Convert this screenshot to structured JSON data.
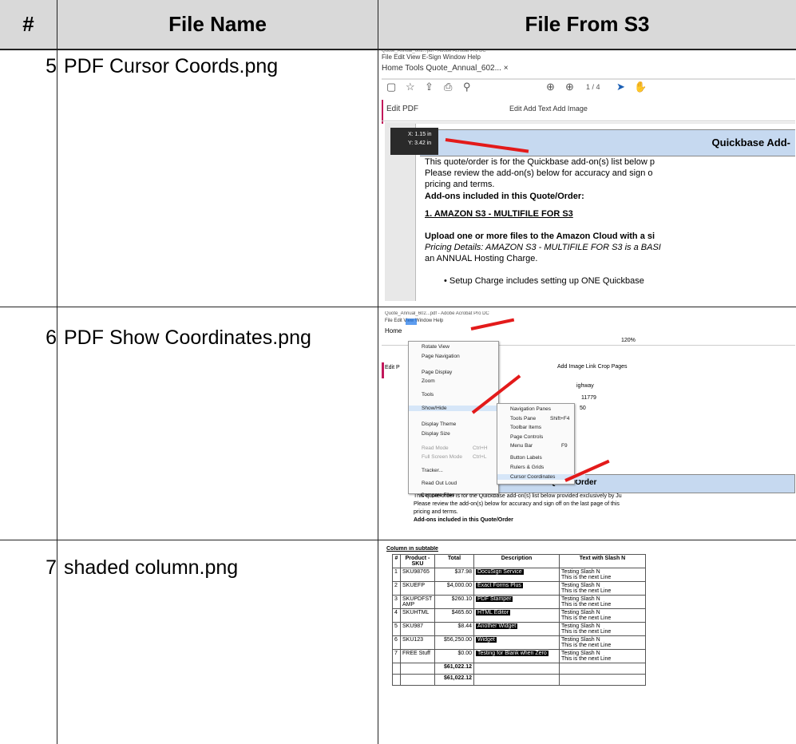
{
  "table": {
    "headers": {
      "num": "#",
      "file_name": "File Name",
      "file_from_s3": "File From S3"
    },
    "rows": [
      {
        "num": "5",
        "file_name": "PDF Cursor Coords.png"
      },
      {
        "num": "6",
        "file_name": "PDF Show Coordinates.png"
      },
      {
        "num": "7",
        "file_name": "shaded column.png"
      }
    ]
  },
  "shot1": {
    "menu": "File  Edit  View  E-Sign  Window  Help",
    "tabs": "Home     Tools       Quote_Annual_602...  ×",
    "page": "1  / 4",
    "edit_pdf": "Edit PDF",
    "tools": "Edit    Add Text    Add Image",
    "coord_x": "X: 1.15 in",
    "coord_y": "Y: 3.42 in",
    "band_title": "Quickbase Add-",
    "lines": [
      "This quote/order is for the Quickbase add-on(s) list below p",
      "Please review the add-on(s) below for accuracy and sign o",
      "pricing and terms.",
      "Add-ons included in this Quote/Order:",
      "1.        AMAZON S3 - MULTIFILE FOR S3",
      "Upload one or more files to the Amazon Cloud with a si",
      "Pricing Details:  AMAZON S3 - MULTIFILE FOR S3 is a BASI",
      "an ANNUAL Hosting Charge.",
      "•   Setup Charge includes setting up ONE Quickbase"
    ]
  },
  "shot2": {
    "title": "Quote_Annual_602...pdf - Adobe Acrobat Pro DC",
    "menubar": "File  Edit  View  Window  Help",
    "home": "Home",
    "edit_p": "Edit P",
    "view_menu": [
      "Rotate View",
      "Page Navigation",
      "Page Display",
      "Zoom",
      "Tools",
      "Show/Hide",
      "Display Theme",
      "Display Size",
      "Read Mode",
      "Full Screen Mode",
      "Tracker...",
      "Read Out Loud",
      "Compare Files"
    ],
    "view_shortcuts": [
      "Ctrl+H",
      "Ctrl+L"
    ],
    "show_menu": [
      "Navigation Panes",
      "Tools Pane",
      "Toolbar Items",
      "Page Controls",
      "Menu Bar",
      "Button Labels",
      "Rulers & Grids",
      "Cursor Coordinates"
    ],
    "show_shortcuts": [
      "Shift+F4",
      "F9"
    ],
    "toolbar_right": "Add Image    Link    Crop Pages",
    "zoom": "120%",
    "side_text": [
      "ighway",
      "11779",
      "50"
    ],
    "band": "dd-on Quote/Order",
    "body": [
      "This quote/order is for the Quickbase add-on(s) list below provided exclusively by Ju",
      "Please review the add-on(s) below for accuracy and sign off on the last page of this",
      "pricing and terms.",
      "Add-ons included in this Quote/Order"
    ]
  },
  "shot3": {
    "caption": "Column in subtable",
    "headers": [
      "#",
      "Product - SKU",
      "Total",
      "Description",
      "Text with Slash N"
    ],
    "rows": [
      [
        "1",
        "SKU98765",
        "$37.98",
        "DocuSign Service",
        "Testing Slash N",
        "This is the next Line"
      ],
      [
        "2",
        "SKUEFP",
        "$4,000.00",
        "Exact Forms Plus",
        "Testing Slash N",
        "This is the next Line"
      ],
      [
        "3",
        "SKUPDFST AMP",
        "$260.10",
        "PDF Stamper",
        "Testing Slash N",
        "This is the next Line"
      ],
      [
        "4",
        "SKUHTML",
        "$465.60",
        "HTML Editor",
        "Testing Slash N",
        "This is the next Line"
      ],
      [
        "5",
        "SKU987",
        "$8.44",
        "Another Widget",
        "Testing Slash N",
        "This is the next Line"
      ],
      [
        "6",
        "SKU123",
        "$56,250.00",
        "Widget",
        "Testing Slash N",
        "This is the next Line"
      ],
      [
        "7",
        "FREE Stuff",
        "$0.00",
        "Testing for Blank when Zero",
        "Testing Slash N",
        "This is the next Line"
      ]
    ],
    "totals": [
      "$61,022.12",
      "$61,022.12"
    ]
  }
}
